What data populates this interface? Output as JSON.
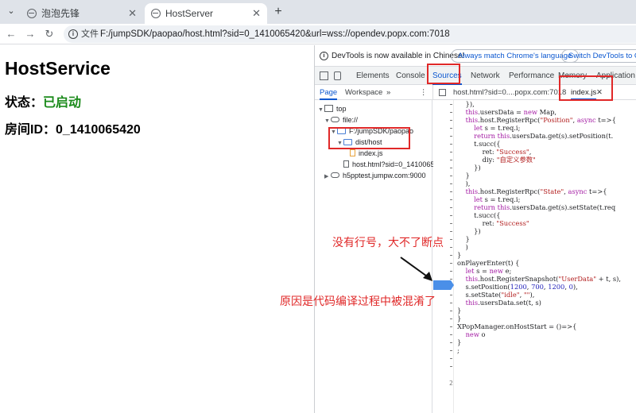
{
  "browser": {
    "tabs": [
      {
        "title": "泡泡先锋",
        "active": false
      },
      {
        "title": "HostServer",
        "active": true
      }
    ],
    "address": {
      "chip": "文件",
      "url": "F:/jumpSDK/paopao/host.html?sid=0_1410065420&url=wss://opendev.popx.com:7018"
    }
  },
  "page": {
    "title": "HostService",
    "status_label": "状态：",
    "status_value": "已启动",
    "room_label": "房间ID：",
    "room_value": "0_1410065420"
  },
  "devtools": {
    "notice": "DevTools is now available in Chinese!",
    "btn_match": "Always match Chrome's language",
    "btn_switch": "Switch DevTools to Chine",
    "tabs": [
      "Elements",
      "Console",
      "Sources",
      "Network",
      "Performance",
      "Memory",
      "Application"
    ],
    "subtabs": [
      "Page",
      "Workspace"
    ],
    "file_tabs": [
      "host.html?sid=0....popx.com:7018",
      "index.js"
    ],
    "tree": {
      "top": "top",
      "file": "file://",
      "folder1": "F:/jumpSDK/paopao",
      "folder2": "dist/host",
      "indexjs": "index.js",
      "hosthtml": "host.html?sid=0_1410065",
      "h5": "h5pptest.jumpw.com:9000"
    },
    "line_numbers": [
      "2"
    ]
  },
  "annotations": {
    "no_line_numbers": "没有行号，大不了断点",
    "reason": "原因是代码编译过程中被混淆了"
  },
  "colors": {
    "accent": "#0b57d0",
    "annotation_red": "#e02828",
    "status_green": "#1a8a1a",
    "breakpoint_blue": "#4a8fe8"
  }
}
